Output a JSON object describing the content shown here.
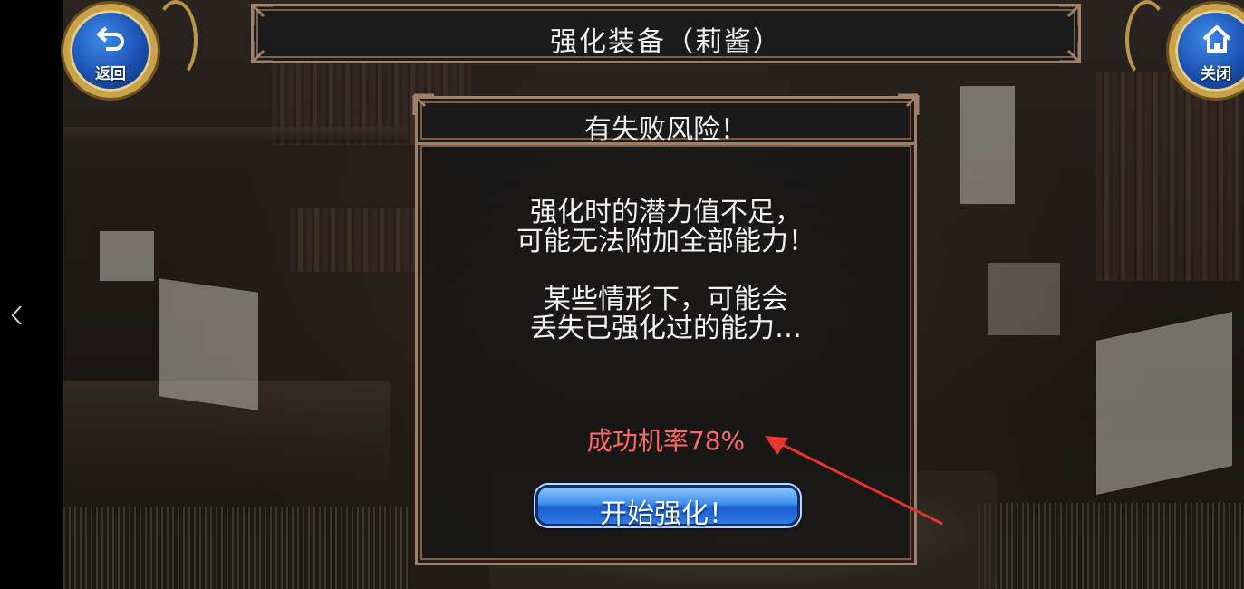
{
  "header": {
    "title": "强化装备（莉酱）",
    "back_label": "返回",
    "close_label": "关闭"
  },
  "dialog": {
    "title": "有失败风险！",
    "message_1_line_1": "强化时的潜力值不足，",
    "message_1_line_2": "可能无法附加全部能力！",
    "message_2_line_1": "某些情形下，可能会",
    "message_2_line_2": "丢失已强化过的能力…",
    "success_rate": "成功机率78%",
    "start_button_label": "开始强化！"
  },
  "colors": {
    "accent_gold": "#c9a24a",
    "frame": "#a08068",
    "rate_red": "#ff6a6a",
    "button_blue": "#3d8ef0",
    "annotation_arrow": "#e8342c"
  },
  "icons": {
    "back": "return-arrow-icon",
    "close": "home-icon",
    "system_back": "chevron-left-icon"
  }
}
